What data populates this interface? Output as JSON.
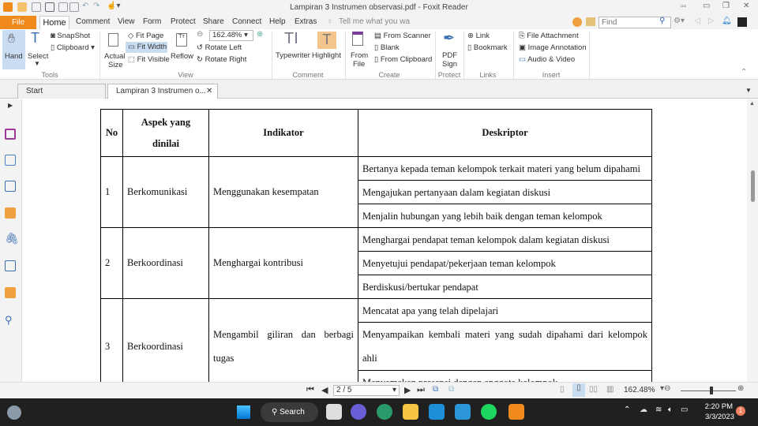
{
  "window": {
    "title": "Lampiran 3 Instrumen observasi.pdf - Foxit Reader"
  },
  "menu": {
    "file": "File",
    "home": "Home",
    "items": [
      "Comment",
      "View",
      "Form",
      "Protect",
      "Share",
      "Connect",
      "Help",
      "Extras"
    ],
    "tell_me": "Tell me what you wa",
    "find_placeholder": "Find"
  },
  "ribbon": {
    "tools": {
      "hand": "Hand",
      "select": "Select",
      "snapshot": "SnapShot",
      "clipboard": "Clipboard",
      "group": "Tools"
    },
    "view": {
      "actual_size_1": "Actual",
      "actual_size_2": "Size",
      "fit_page": "Fit Page",
      "fit_width": "Fit Width",
      "fit_visible": "Fit Visible",
      "reflow": "Reflow",
      "zoom": "162.48%",
      "rotate_left": "Rotate Left",
      "rotate_right": "Rotate Right",
      "group": "View"
    },
    "comment": {
      "typewriter": "Typewriter",
      "highlight": "Highlight",
      "group": "Comment"
    },
    "create": {
      "from_file_1": "From",
      "from_file_2": "File",
      "from_scanner": "From Scanner",
      "blank": "Blank",
      "from_clipboard": "From Clipboard",
      "group": "Create"
    },
    "protect": {
      "pdf_sign_1": "PDF",
      "pdf_sign_2": "Sign",
      "group": "Protect"
    },
    "links": {
      "link": "Link",
      "bookmark": "Bookmark",
      "group": "Links"
    },
    "insert": {
      "file_attachment": "File Attachment",
      "image_annotation": "Image Annotation",
      "audio_video": "Audio & Video",
      "group": "Insert"
    }
  },
  "tabs": {
    "start": "Start",
    "doc": "Lampiran 3 Instrumen o..."
  },
  "table": {
    "headers": {
      "no": "No",
      "aspek_1": "Aspek yang",
      "aspek_2": "dinilai",
      "indikator": "Indikator",
      "deskriptor": "Deskriptor"
    },
    "rows": [
      {
        "no": "1",
        "aspek": "Berkomunikasi",
        "indikator": "Menggunakan kesempatan",
        "desc": [
          "Bertanya kepada teman kelompok terkait materi yang belum dipahami",
          "Mengajukan pertanyaan dalam kegiatan diskusi",
          "Menjalin hubungan yang lebih baik dengan teman kelompok"
        ]
      },
      {
        "no": "2",
        "aspek": "Berkoordinasi",
        "indikator": "Menghargai kontribusi",
        "desc": [
          "Menghargai pendapat teman kelompok dalam kegiatan diskusi",
          "Menyetujui pendapat/pekerjaan teman kelompok",
          "Berdiskusi/bertukar pendapat"
        ]
      },
      {
        "no": "3",
        "aspek": "Berkoordinasi",
        "indikator": "Mengambil giliran dan berbagi tugas",
        "desc": [
          "Mencatat apa yang telah dipelajari",
          "Menyampaikan kembali materi yang sudah dipahami dari kelompok ahli",
          "Menyamakan presepsi dengan anggota kelompok"
        ]
      }
    ]
  },
  "status": {
    "page": "2 / 5",
    "zoom": "162.48%"
  },
  "taskbar": {
    "search": "Search",
    "time": "2:20 PM",
    "date": "3/3/2023",
    "badge": "1"
  }
}
